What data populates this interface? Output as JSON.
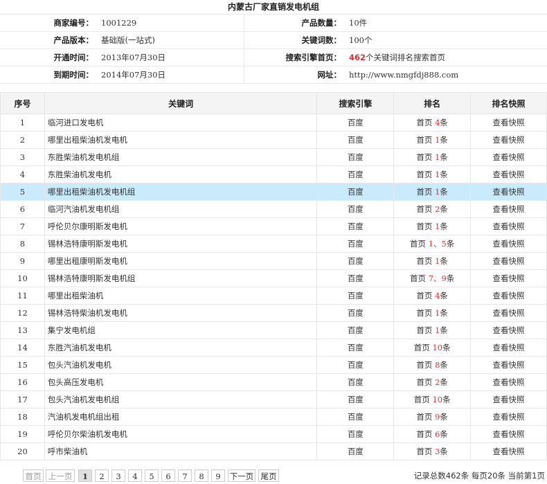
{
  "title": "内蒙古厂家直销发电机组",
  "info": {
    "merchant_id_label": "商家编号：",
    "merchant_id": "1001229",
    "product_count_label": "产品数量：",
    "product_count": "10件",
    "version_label": "产品版本：",
    "version": "基础版(一站式)",
    "keyword_count_label": "关键词数：",
    "keyword_count": "100个",
    "open_time_label": "开通时间：",
    "open_time": "2013年07月30日",
    "engine_home_label": "搜索引擎首页：",
    "engine_home_num": "462",
    "engine_home_text": "个关键词排名搜索首页",
    "expire_time_label": "到期时间：",
    "expire_time": "2014年07月30日",
    "url_label": "网址：",
    "url": "http://www.nmgfdj888.com"
  },
  "table": {
    "headers": [
      "序号",
      "关键词",
      "搜索引擎",
      "排名",
      "排名快照"
    ],
    "highlight_row": 5,
    "rows": [
      {
        "idx": "1",
        "kw": "临河进口发电机",
        "se": "百度",
        "prefix": "首页",
        "rank": "4",
        "suffix": "条",
        "snap": "查看快照"
      },
      {
        "idx": "2",
        "kw": "哪里出租柴油机发电机",
        "se": "百度",
        "prefix": "首页",
        "rank": "1",
        "suffix": "条",
        "snap": "查看快照"
      },
      {
        "idx": "3",
        "kw": "东胜柴油机发电机组",
        "se": "百度",
        "prefix": "首页",
        "rank": "1",
        "suffix": "条",
        "snap": "查看快照"
      },
      {
        "idx": "4",
        "kw": "东胜柴油机发电机",
        "se": "百度",
        "prefix": "首页",
        "rank": "1",
        "suffix": "条",
        "snap": "查看快照"
      },
      {
        "idx": "5",
        "kw": "哪里出租柴油机发电机组",
        "se": "百度",
        "prefix": "首页",
        "rank": "1",
        "suffix": "条",
        "snap": "查看快照"
      },
      {
        "idx": "6",
        "kw": "临河汽油机发电机组",
        "se": "百度",
        "prefix": "首页",
        "rank": "2",
        "suffix": "条",
        "snap": "查看快照"
      },
      {
        "idx": "7",
        "kw": "呼伦贝尔康明斯发电机",
        "se": "百度",
        "prefix": "首页",
        "rank": "1",
        "suffix": "条",
        "snap": "查看快照"
      },
      {
        "idx": "8",
        "kw": "锡林浩特康明斯发电机",
        "se": "百度",
        "prefix": "首页",
        "rank": "1、5",
        "suffix": "条",
        "snap": "查看快照"
      },
      {
        "idx": "9",
        "kw": "哪里出租康明斯发电机",
        "se": "百度",
        "prefix": "首页",
        "rank": "1",
        "suffix": "条",
        "snap": "查看快照"
      },
      {
        "idx": "10",
        "kw": "锡林浩特康明斯发电机组",
        "se": "百度",
        "prefix": "首页",
        "rank": "7、9",
        "suffix": "条",
        "snap": "查看快照"
      },
      {
        "idx": "11",
        "kw": "哪里出租柴油机",
        "se": "百度",
        "prefix": "首页",
        "rank": "4",
        "suffix": "条",
        "snap": "查看快照"
      },
      {
        "idx": "12",
        "kw": "锡林浩特柴油机发电机",
        "se": "百度",
        "prefix": "首页",
        "rank": "1",
        "suffix": "条",
        "snap": "查看快照"
      },
      {
        "idx": "13",
        "kw": "集宁发电机组",
        "se": "百度",
        "prefix": "首页",
        "rank": "1",
        "suffix": "条",
        "snap": "查看快照"
      },
      {
        "idx": "14",
        "kw": "东胜汽油机发电机",
        "se": "百度",
        "prefix": "首页",
        "rank": "10",
        "suffix": "条",
        "snap": "查看快照"
      },
      {
        "idx": "15",
        "kw": "包头汽油机发电机",
        "se": "百度",
        "prefix": "首页",
        "rank": "8",
        "suffix": "条",
        "snap": "查看快照"
      },
      {
        "idx": "16",
        "kw": "包头高压发电机",
        "se": "百度",
        "prefix": "首页",
        "rank": "2",
        "suffix": "条",
        "snap": "查看快照"
      },
      {
        "idx": "17",
        "kw": "包头汽油机发电机组",
        "se": "百度",
        "prefix": "首页",
        "rank": "10",
        "suffix": "条",
        "snap": "查看快照"
      },
      {
        "idx": "18",
        "kw": "汽油机发电机组出租",
        "se": "百度",
        "prefix": "首页",
        "rank": "9",
        "suffix": "条",
        "snap": "查看快照"
      },
      {
        "idx": "19",
        "kw": "呼伦贝尔柴油机发电机",
        "se": "百度",
        "prefix": "首页",
        "rank": "6",
        "suffix": "条",
        "snap": "查看快照"
      },
      {
        "idx": "20",
        "kw": "呼市柴油机",
        "se": "百度",
        "prefix": "首页",
        "rank": "3",
        "suffix": "条",
        "snap": "查看快照"
      }
    ]
  },
  "pager": {
    "first": "首页",
    "prev": "上一页",
    "pages": [
      "1",
      "2",
      "3",
      "4",
      "5",
      "6",
      "7",
      "8",
      "9"
    ],
    "current": "1",
    "next": "下一页",
    "last": "尾页",
    "summary": "记录总数462条 每页20条 当前第1页"
  },
  "colors": {
    "rank_red": "#e03030",
    "highlight_row_bg": "#c9ebfb"
  }
}
